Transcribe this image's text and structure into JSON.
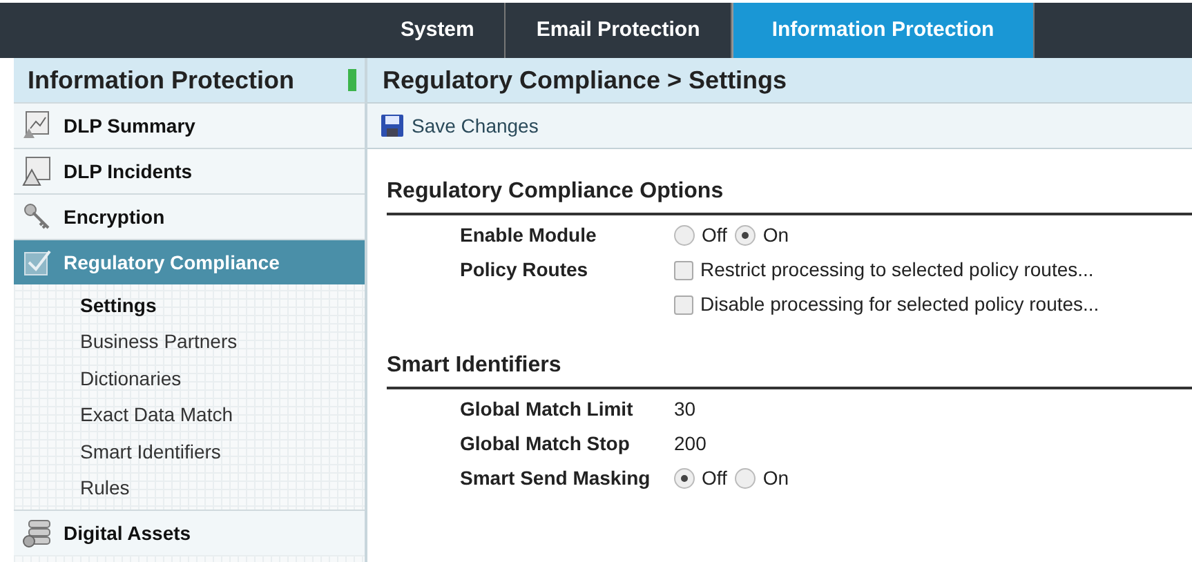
{
  "top_tabs": [
    {
      "label": "System",
      "selected": false
    },
    {
      "label": "Email Protection",
      "selected": false
    },
    {
      "label": "Information Protection",
      "selected": true
    }
  ],
  "sidebar": {
    "title": "Information Protection",
    "items": [
      {
        "label": "DLP Summary",
        "selected": false
      },
      {
        "label": "DLP Incidents",
        "selected": false
      },
      {
        "label": "Encryption",
        "selected": false
      },
      {
        "label": "Regulatory Compliance",
        "selected": true,
        "children": [
          {
            "label": "Settings",
            "selected": true
          },
          {
            "label": "Business Partners",
            "selected": false
          },
          {
            "label": "Dictionaries",
            "selected": false
          },
          {
            "label": "Exact Data Match",
            "selected": false
          },
          {
            "label": "Smart Identifiers",
            "selected": false
          },
          {
            "label": "Rules",
            "selected": false
          }
        ]
      },
      {
        "label": "Digital Assets",
        "selected": false
      }
    ]
  },
  "main": {
    "title": "Regulatory Compliance > Settings",
    "toolbar": {
      "save_label": "Save Changes"
    },
    "sections": [
      {
        "heading": "Regulatory Compliance Options",
        "fields": [
          {
            "label": "Enable Module",
            "kind": "radio",
            "options": [
              {
                "label": "Off",
                "selected": false
              },
              {
                "label": "On",
                "selected": true
              }
            ]
          },
          {
            "label": "Policy Routes",
            "kind": "checkboxes",
            "options": [
              {
                "label": "Restrict processing to selected policy routes...",
                "checked": false
              },
              {
                "label": "Disable processing for selected policy routes...",
                "checked": false
              }
            ]
          }
        ]
      },
      {
        "heading": "Smart Identifiers",
        "fields": [
          {
            "label": "Global Match Limit",
            "kind": "text",
            "value": "30"
          },
          {
            "label": "Global Match Stop",
            "kind": "text",
            "value": "200"
          },
          {
            "label": "Smart Send Masking",
            "kind": "radio",
            "options": [
              {
                "label": "Off",
                "selected": true
              },
              {
                "label": "On",
                "selected": false
              }
            ]
          }
        ]
      }
    ]
  }
}
